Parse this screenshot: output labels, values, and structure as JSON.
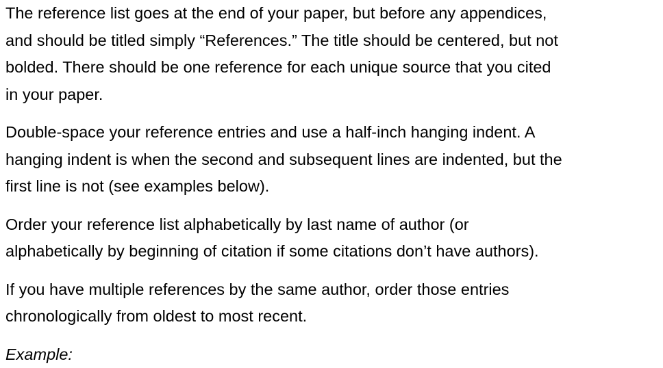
{
  "paragraphs": [
    {
      "lines": [
        "The reference list goes at the end of your paper, but before any appendices,",
        "and should be titled simply “References.” The title should be centered, but not",
        "bolded. There should be one reference for each unique source that you cited",
        "in your paper."
      ]
    },
    {
      "lines": [
        "Double-space your reference entries and use a half-inch hanging indent. A",
        "hanging indent is when the second and subsequent lines are indented, but the",
        "first line is not (see examples below)."
      ]
    },
    {
      "lines": [
        "Order your reference list alphabetically by last name of author (or",
        "alphabetically by beginning of citation if some citations don’t have authors)."
      ]
    },
    {
      "lines": [
        "If you have multiple references by the same author, order those entries",
        "chronologically from oldest to most recent."
      ]
    }
  ],
  "example_label": "Example:"
}
